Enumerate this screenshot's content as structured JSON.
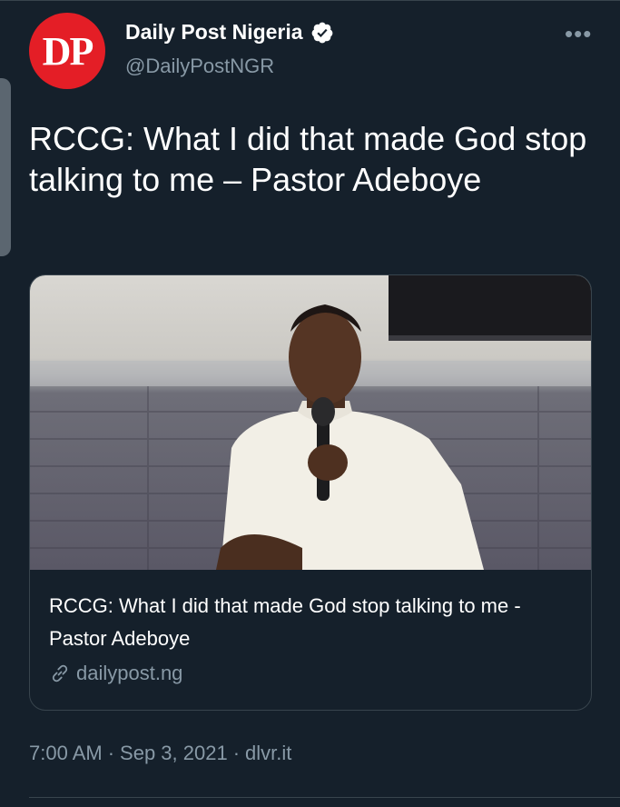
{
  "author": {
    "avatar_text": "DP",
    "name": "Daily Post Nigeria",
    "handle": "@DailyPostNGR",
    "verified_icon": "verified-badge-icon",
    "more_icon": "more-options-icon",
    "more_label": "•••"
  },
  "tweet": {
    "text": "RCCG: What I did that made God stop talking to me – Pastor Adeboye"
  },
  "card": {
    "title": "RCCG: What I did that made God stop talking to me - Pastor Adeboye",
    "domain": "dailypost.ng",
    "link_icon": "link-icon"
  },
  "meta": {
    "time": "7:00 AM",
    "sep1": "·",
    "date": "Sep 3, 2021",
    "sep2": "·",
    "source": "dlvr.it"
  },
  "colors": {
    "background": "#15202b",
    "text_primary": "#ffffff",
    "text_secondary": "#8899a6",
    "border": "#38444d",
    "avatar_red": "#e41e26"
  }
}
